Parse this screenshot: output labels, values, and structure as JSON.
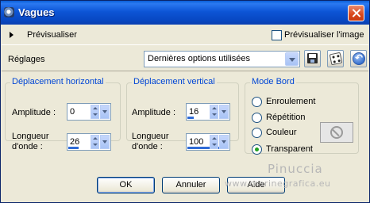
{
  "window": {
    "title": "Vagues"
  },
  "preview_bar": {
    "preview_label": "Prévisualiser",
    "preview_image_label": "Prévisualiser l'image",
    "preview_image_checked": false
  },
  "presets": {
    "label": "Réglages",
    "selected": "Dernières options utilisées"
  },
  "horizontal": {
    "title": "Déplacement horizontal",
    "amplitude_label": "Amplitude :",
    "amplitude_value": "0",
    "wavelength_label_1": "Longueur",
    "wavelength_label_2": "d'onde :",
    "wavelength_value": "26"
  },
  "vertical": {
    "title": "Déplacement vertical",
    "amplitude_label": "Amplitude :",
    "amplitude_value": "16",
    "wavelength_label_1": "Longueur",
    "wavelength_label_2": "d'onde :",
    "wavelength_value": "100"
  },
  "edge_mode": {
    "title": "Mode Bord",
    "options": [
      {
        "label": "Enroulement",
        "checked": false
      },
      {
        "label": "Répétition",
        "checked": false
      },
      {
        "label": "Couleur",
        "checked": false
      },
      {
        "label": "Transparent",
        "checked": true
      }
    ]
  },
  "buttons": {
    "ok": "OK",
    "cancel": "Annuler",
    "help": "Aide"
  },
  "watermark": {
    "name": "Pinuccia",
    "url": "www.marinegrafica.eu"
  },
  "colors": {
    "title_bar": "#0a5fd8",
    "group_title": "#0046d5",
    "dialog_bg": "#ece9d8"
  }
}
